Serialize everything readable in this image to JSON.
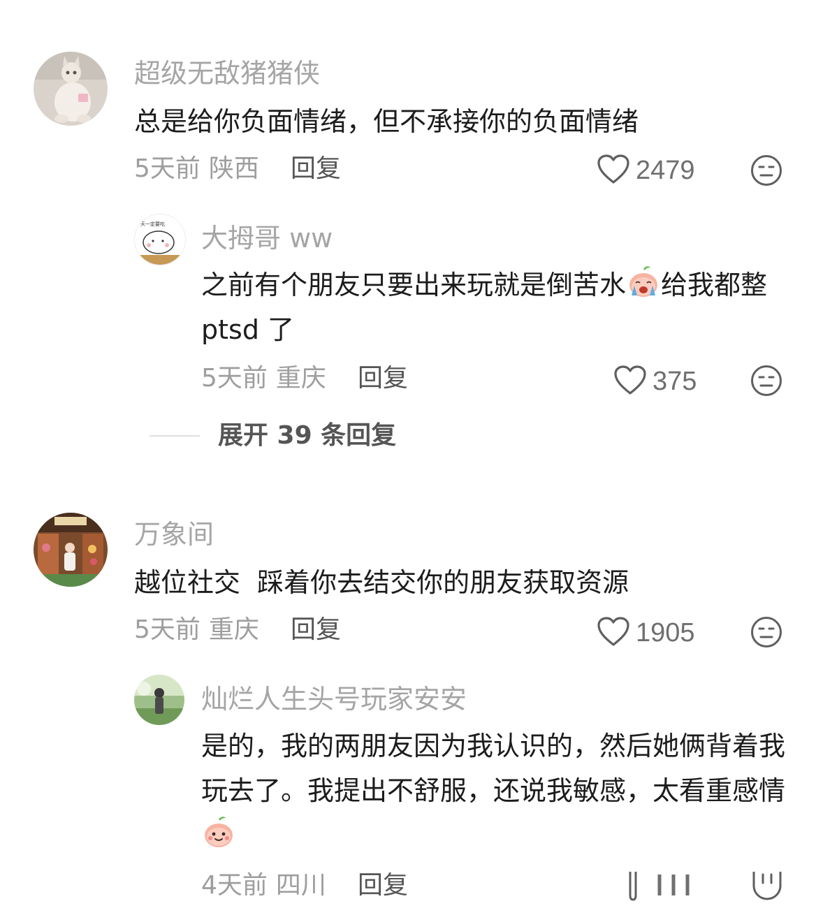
{
  "comments": [
    {
      "user": "超级无敌猪猪侠",
      "text": "总是给你负面情绪，但不承接你的负面情绪",
      "time": "5天前",
      "location": "陕西",
      "reply_label": "回复",
      "likes": "2479",
      "icons": {
        "like": "heart-outline-icon",
        "dislike": "neutral-face-icon"
      },
      "replies": [
        {
          "user": "大拇哥 ww",
          "text_before_emoji": "之前有个朋友只要出来玩就是倒苦水",
          "emoji": "crying-peach-emoji",
          "text_after_emoji": "给我都整 ptsd 了",
          "time": "5天前",
          "location": "重庆",
          "reply_label": "回复",
          "likes": "375"
        }
      ],
      "expand_label": "展开 39 条回复"
    },
    {
      "user": "万象间",
      "text": "越位社交  踩着你去结交你的朋友获取资源",
      "time": "5天前",
      "location": "重庆",
      "reply_label": "回复",
      "likes": "1905",
      "replies": [
        {
          "user": "灿烂人生头号玩家安安",
          "text": "是的，我的两朋友因为我认识的，然后她俩背着我玩去了。我提出不舒服，还说我敏感，太看重感情",
          "emoji": "smiling-peach-emoji",
          "time": "4天前",
          "location": "四川",
          "reply_label": "回复"
        }
      ]
    }
  ],
  "colors": {
    "username": "#a5a5a5",
    "body": "#1c1c1c",
    "meta": "#9e9e9e",
    "action": "#555555"
  }
}
